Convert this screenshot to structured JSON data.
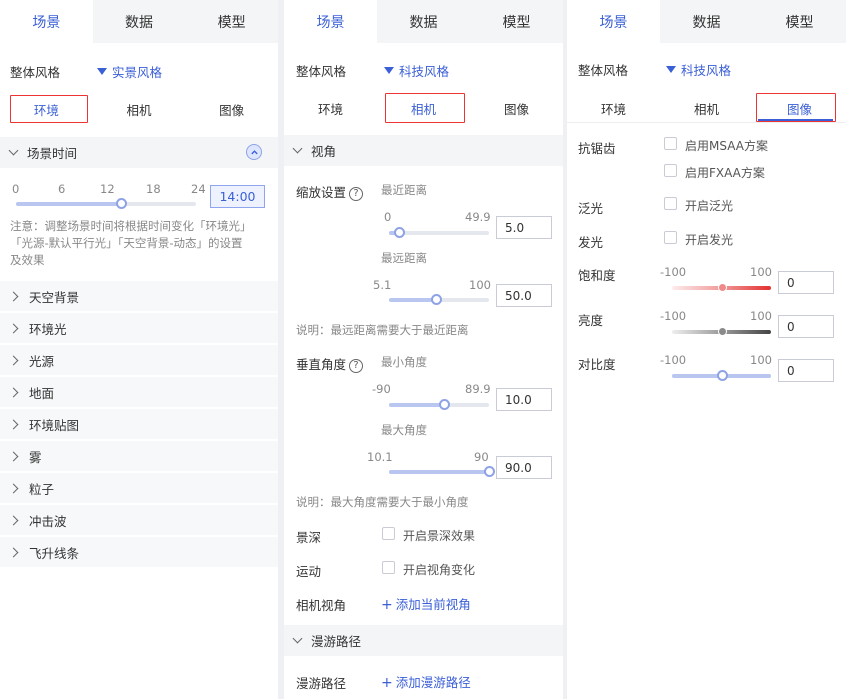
{
  "panel1": {
    "nav": [
      "场景",
      "数据",
      "模型"
    ],
    "style_label": "整体风格",
    "style_value": "实景风格",
    "subtabs": [
      "环境",
      "相机",
      "图像"
    ],
    "section_time": "场景时间",
    "ticks": [
      "0",
      "6",
      "12",
      "18",
      "24"
    ],
    "time_value": "14:00",
    "time_fraction": 0.583,
    "note_lines": [
      "注意：调整场景时间将根据时间变化「环境光」",
      "「光源-默认平行光」「天空背景-动态」的设置",
      "及效果"
    ],
    "items": [
      "天空背景",
      "环境光",
      "光源",
      "地面",
      "环境贴图",
      "雾",
      "粒子",
      "冲击波",
      "飞升线条"
    ]
  },
  "panel2": {
    "nav": [
      "场景",
      "数据",
      "模型"
    ],
    "style_label": "整体风格",
    "style_value": "科技风格",
    "subtabs": [
      "环境",
      "相机",
      "图像"
    ],
    "section_view": "视角",
    "zoom_label": "缩放设置",
    "near_label": "最近距离",
    "near_min": "0",
    "near_max": "49.9",
    "near_value": "5.0",
    "near_fraction": 0.1,
    "far_label": "最远距离",
    "far_min": "5.1",
    "far_max": "100",
    "far_value": "50.0",
    "far_fraction": 0.47,
    "zoom_note": "说明：最远距离需要大于最近距离",
    "vertical_label": "垂直角度",
    "minangle_label": "最小角度",
    "minangle_min": "-90",
    "minangle_max": "89.9",
    "minangle_value": "10.0",
    "minangle_fraction": 0.55,
    "maxangle_label": "最大角度",
    "maxangle_min": "10.1",
    "maxangle_max": "90",
    "maxangle_value": "90.0",
    "maxangle_fraction": 1.0,
    "angle_note": "说明：最大角度需要大于最小角度",
    "dof_label": "景深",
    "dof_check": "开启景深效果",
    "motion_label": "运动",
    "motion_check": "开启视角变化",
    "camview_label": "相机视角",
    "camview_add": "添加当前视角",
    "section_path": "漫游路径",
    "path_label": "漫游路径",
    "path_add": "添加漫游路径"
  },
  "panel3": {
    "nav": [
      "场景",
      "数据",
      "模型"
    ],
    "style_label": "整体风格",
    "style_value": "科技风格",
    "subtabs": [
      "环境",
      "相机",
      "图像"
    ],
    "aa_label": "抗锯齿",
    "msaa": "启用MSAA方案",
    "fxaa": "启用FXAA方案",
    "bloom_label": "泛光",
    "bloom_check": "开启泛光",
    "glow_label": "发光",
    "glow_check": "开启发光",
    "saturation_label": "饱和度",
    "brightness_label": "亮度",
    "contrast_label": "对比度",
    "range_min": "-100",
    "range_max": "100",
    "saturation_value": "0",
    "brightness_value": "0",
    "contrast_value": "0"
  },
  "colors": {
    "accent": "#3a5fd6",
    "highlight_box": "#ee3333",
    "panel_gap": "#eef0f3",
    "section_bg": "#f4f5f7"
  }
}
